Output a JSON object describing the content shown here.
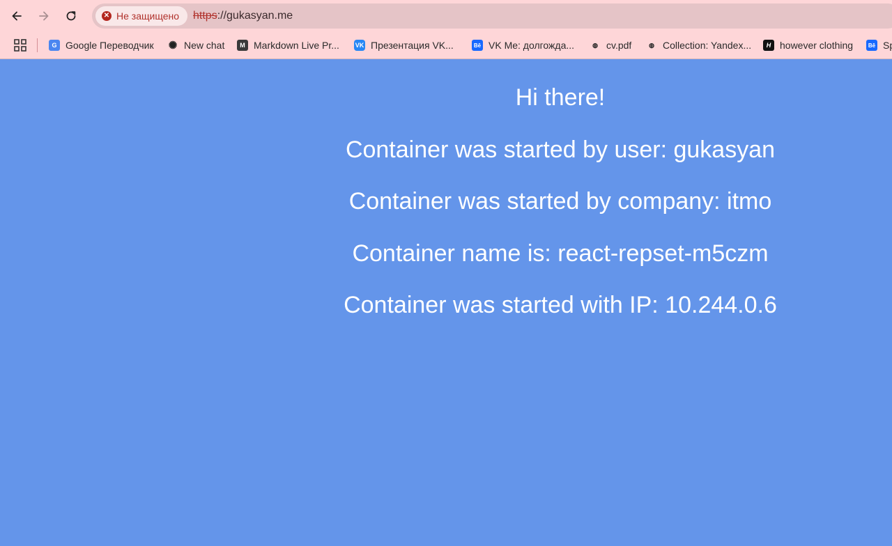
{
  "browser": {
    "security_label": "Не защищено",
    "url_scheme": "https",
    "url_rest": "://gukasyan.me",
    "bookmarks": [
      {
        "label": "Google Переводчик",
        "icon": "google-translate-icon",
        "glyph": "G"
      },
      {
        "label": "New chat",
        "icon": "chatgpt-icon",
        "glyph": "✺"
      },
      {
        "label": "Markdown Live Pr...",
        "icon": "markdown-icon",
        "glyph": "M"
      },
      {
        "label": "Презентация VK...",
        "icon": "vk-icon",
        "glyph": "VK"
      },
      {
        "label": "VK Me: долгожда...",
        "icon": "behance-icon",
        "glyph": "Bē"
      },
      {
        "label": "cv.pdf",
        "icon": "globe-icon",
        "glyph": "◍"
      },
      {
        "label": "Collection: Yandex...",
        "icon": "globe-icon",
        "glyph": "◍"
      },
      {
        "label": "however clothing",
        "icon": "however-icon",
        "glyph": "H"
      },
      {
        "label": "Sp",
        "icon": "behance-icon",
        "glyph": "Bē"
      }
    ]
  },
  "page": {
    "background": "#6495ea",
    "lines": [
      "Hi there!",
      "Container was started by user: gukasyan",
      "Container was started by company: itmo",
      "Container name is: react-repset-m5czm",
      "Container was started with IP: 10.244.0.6"
    ]
  }
}
